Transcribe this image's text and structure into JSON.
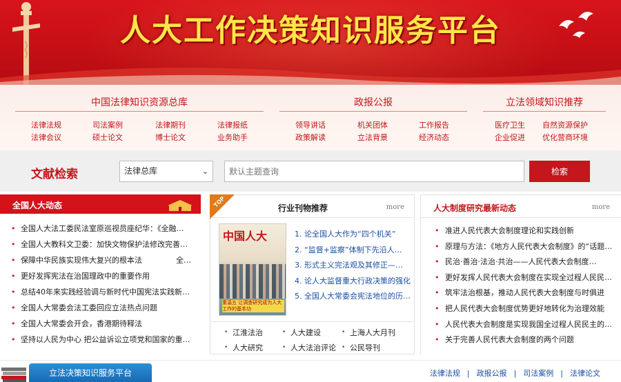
{
  "banner": {
    "title": "人大工作决策知识服务平台"
  },
  "nav": {
    "col1": {
      "head": "中国法律知识资源总库",
      "links": [
        "法律法规",
        "司法案例",
        "法律期刊",
        "法律报纸",
        "法律会议",
        "硕士论文",
        "博士论文",
        "业务助手"
      ]
    },
    "col2": {
      "head": "政报公报",
      "links": [
        "领导讲话",
        "机关团体",
        "工作报告",
        "政策解读",
        "立法背景",
        "经济动态"
      ]
    },
    "col3": {
      "head": "立法领域知识推荐",
      "links": [
        "医疗卫生",
        "自然资源保护",
        "企业促进",
        "优化营商环境"
      ]
    }
  },
  "search": {
    "label": "文献检索",
    "select_value": "法律总库",
    "placeholder": "默认主题查询",
    "button": "检索"
  },
  "left_panel": {
    "title": "全国人大动态",
    "items": [
      "全国人大法工委民法室原巡视员座纪华：《全融…",
      "全国人大教科文卫委：加快文物保护法修改完善…",
      "保障中华民族实现伟大复兴的根本法",
      "更好发挥宪法在治国理政中的重要作用",
      "总结40年来实践经验调与新时代中国宪法实践新…",
      "全国人大常委会法工委回应立法热点问题",
      "全国人大常委会开会，香港期待释法",
      "坚持以人民为中心 把公益诉讼立项党和国家的重…"
    ],
    "item_suffix": "全…"
  },
  "mid_panel": {
    "title": "行业刊物推荐",
    "more": "more",
    "badge": "TOP",
    "cover_title": "中国人大",
    "cover_sub": "重温五 让调查研究成为人大工作的基本功",
    "items": [
      "1. 论全国人大作为“四个机关”",
      "2. “监督+监察”体制下先沿人…",
      "3. 形式主义完法观及其修正—…",
      "4. 论人大监督重大行政决策的强化",
      "5. 全国人大常委会宪法地位的历…"
    ],
    "journals": [
      "江淮法治",
      "人大建设",
      "上海人大月刊",
      "人大研究",
      "人大法治评论",
      "公民导刊"
    ]
  },
  "right_panel": {
    "title": "人大制度研究最新动态",
    "more": "more",
    "items": [
      "准进人民代表大会制度理论和实践创新",
      "原理与方法：《地方人民代表大会制度》的“话题…",
      "民治·善治·法治·共治——人民代表大会制度…",
      "更好发挥人民代表大会制度在实现全过程人民民…",
      "筑牢法治根基，推动人民代表大会制度与时俱进",
      "把人民代表大会制度优势更好地转化为治理效能",
      "人民代表大会制度是实现我国全过程人民民主的…",
      "关于完善人民代表大会制度的两个问题"
    ]
  },
  "footer": {
    "tab": "立法决策知识服务平台",
    "links": [
      "法律法规",
      "政报公报",
      "司法案例",
      "法律论文"
    ]
  },
  "colors": {
    "brand_red": "#c4161c",
    "link_blue": "#1a4fa3",
    "footer_blue": "#1769b3"
  }
}
